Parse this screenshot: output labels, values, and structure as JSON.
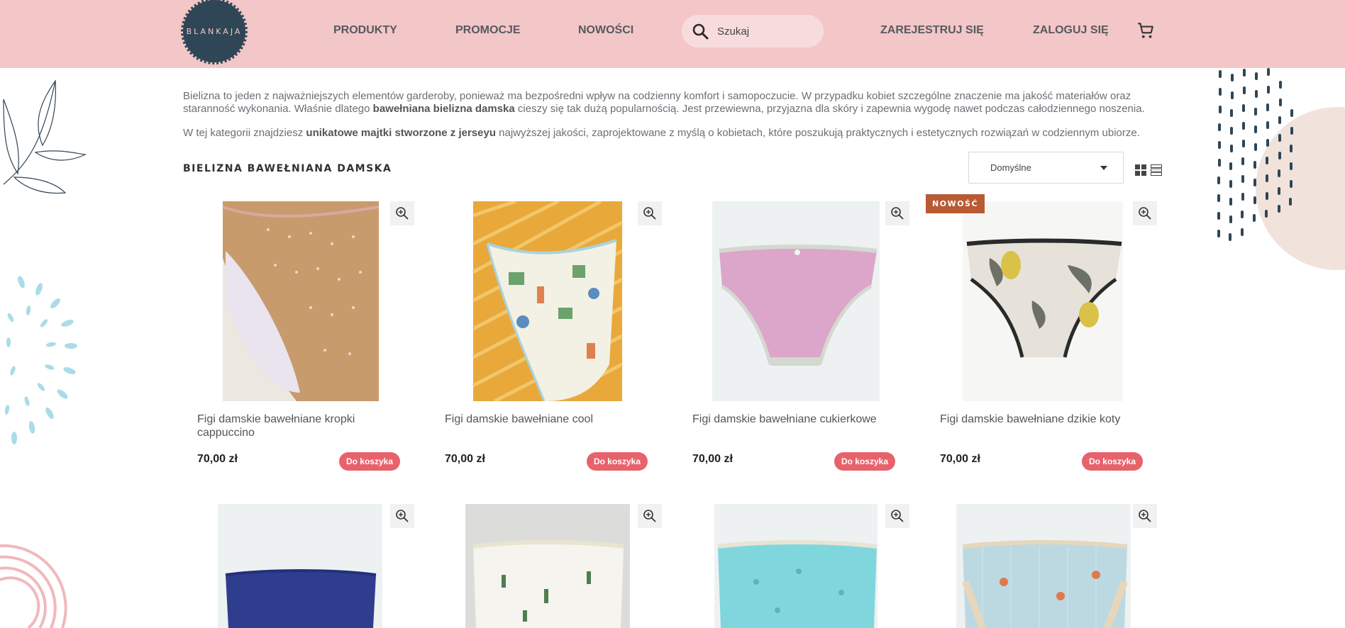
{
  "brand": {
    "logo_text": "BLANKAJA"
  },
  "nav": {
    "products": "PRODUKTY",
    "promotions": "PROMOCJE",
    "news": "NOWOŚCI",
    "register": "ZAREJESTRUJ SIĘ",
    "login": "ZALOGUJ SIĘ"
  },
  "search": {
    "placeholder": "Szukaj"
  },
  "intro": {
    "p1_a": "Bielizna to jeden z najważniejszych elementów garderoby, ponieważ ma bezpośredni wpływ na codzienny komfort i samopoczucie. W przypadku kobiet szczególne znaczenie ma jakość materiałów oraz staranność wykonania. Właśnie dlatego ",
    "p1_b": "bawełniana bielizna damska",
    "p1_c": " cieszy się tak dużą popularnością. Jest przewiewna, przyjazna dla skóry i zapewnia wygodę nawet podczas całodziennego noszenia.",
    "p2_a": "W tej kategorii znajdziesz ",
    "p2_b": "unikatowe majtki stworzone z jerseyu",
    "p2_c": " najwyższej jakości, zaprojektowane z myślą o kobietach, które poszukują praktycznych i estetycznych rozwiązań w codziennym ubiorze."
  },
  "category": {
    "title": "BIELIZNA BAWEŁNIANA DAMSKA"
  },
  "sort": {
    "selected": "Domyślne"
  },
  "products": [
    {
      "name": "Figi damskie bawełniane kropki cappuccino",
      "price": "70,00 zł",
      "cta": "Do koszyka"
    },
    {
      "name": "Figi damskie bawełniane cool",
      "price": "70,00 zł",
      "cta": "Do koszyka"
    },
    {
      "name": "Figi damskie bawełniane cukierkowe",
      "price": "70,00 zł",
      "cta": "Do koszyka"
    },
    {
      "name": "Figi damskie bawełniane dzikie koty",
      "price": "70,00 zł",
      "cta": "Do koszyka",
      "badge": "NOWOŚĆ"
    }
  ],
  "colors": {
    "header_bg": "#f3c6c8",
    "accent_button": "#e8626b",
    "badge": "#b85b35",
    "logo": "#2f4656"
  },
  "icons": [
    "search-icon",
    "cart-icon",
    "zoom-icon",
    "grid-view-icon",
    "list-view-icon",
    "chevron-down-icon"
  ]
}
